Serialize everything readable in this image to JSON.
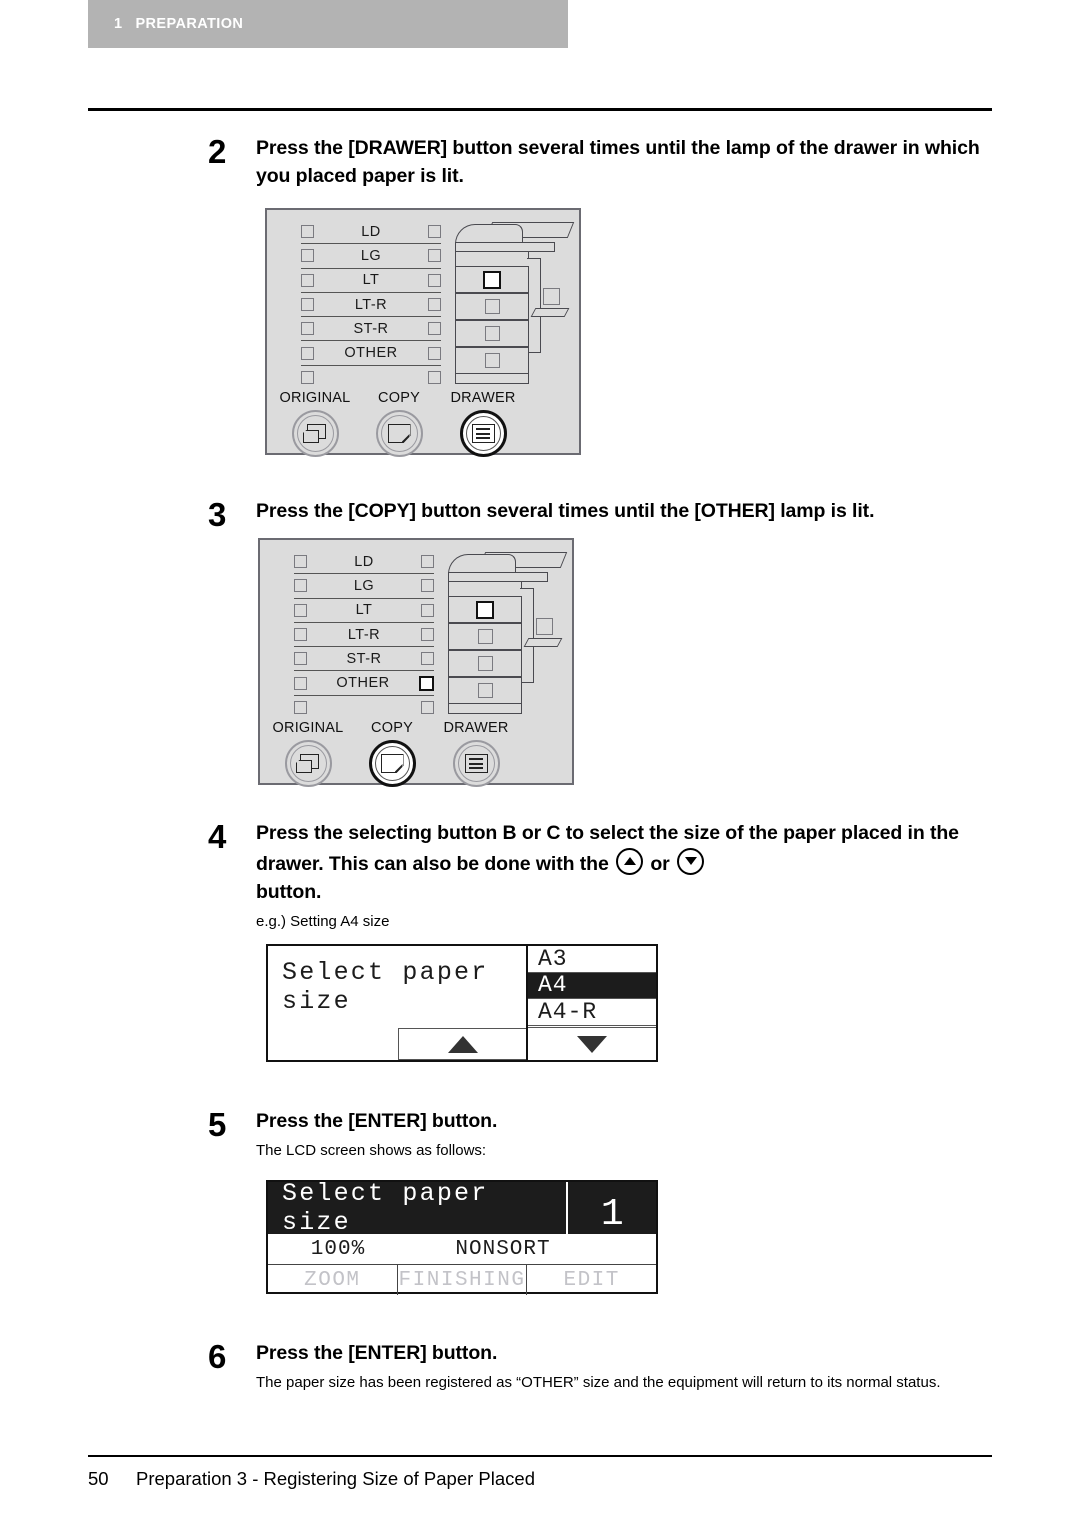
{
  "header": {
    "chapter_number": "1",
    "chapter_title": "PREPARATION"
  },
  "steps": [
    {
      "number": "2",
      "title": "Press the [DRAWER] button several times until the lamp of the drawer in which you placed paper is lit.",
      "sub": ""
    },
    {
      "number": "3",
      "title": "Press the [COPY] button several times until the [OTHER] lamp is lit.",
      "sub": ""
    },
    {
      "number": "4",
      "title_part1": "Press the selecting button B or C to select the size of the paper placed in the drawer. This can also be done with the",
      "title_or": "or",
      "title_part2": "button.",
      "sub": "e.g.) Setting A4 size"
    },
    {
      "number": "5",
      "title": "Press the [ENTER] button.",
      "sub": "The LCD screen shows as follows:"
    },
    {
      "number": "6",
      "title": "Press the [ENTER] button.",
      "sub": "The paper size has been registered as “OTHER” size and the equipment will return to its normal status."
    }
  ],
  "panel_figures": [
    {
      "caption": "drawer-button-step",
      "lamp_rows": [
        {
          "label": "LD",
          "left_lit": false,
          "right_lit": false
        },
        {
          "label": "LG",
          "left_lit": false,
          "right_lit": false
        },
        {
          "label": "LT",
          "left_lit": false,
          "right_lit": false
        },
        {
          "label": "LT-R",
          "left_lit": false,
          "right_lit": false
        },
        {
          "label": "ST-R",
          "left_lit": false,
          "right_lit": false
        },
        {
          "label": "OTHER",
          "left_lit": false,
          "right_lit": false
        },
        {
          "label": "",
          "left_lit": false,
          "right_lit": false
        }
      ],
      "buttons": [
        {
          "label": "ORIGINAL",
          "icon": "original-sheet-icon",
          "active": false
        },
        {
          "label": "COPY",
          "icon": "copy-sheet-icon",
          "active": false
        },
        {
          "label": "DRAWER",
          "icon": "drawer-lines-icon",
          "active": true
        }
      ],
      "machine_drawer_lit_index": 0
    },
    {
      "caption": "copy-button-step",
      "lamp_rows": [
        {
          "label": "LD",
          "left_lit": false,
          "right_lit": false
        },
        {
          "label": "LG",
          "left_lit": false,
          "right_lit": false
        },
        {
          "label": "LT",
          "left_lit": false,
          "right_lit": false
        },
        {
          "label": "LT-R",
          "left_lit": false,
          "right_lit": false
        },
        {
          "label": "ST-R",
          "left_lit": false,
          "right_lit": false
        },
        {
          "label": "OTHER",
          "left_lit": false,
          "right_lit": true
        },
        {
          "label": "",
          "left_lit": false,
          "right_lit": false
        }
      ],
      "buttons": [
        {
          "label": "ORIGINAL",
          "icon": "original-sheet-icon",
          "active": false
        },
        {
          "label": "COPY",
          "icon": "copy-sheet-icon",
          "active": true
        },
        {
          "label": "DRAWER",
          "icon": "drawer-lines-icon",
          "active": false
        }
      ],
      "machine_drawer_lit_index": 0
    }
  ],
  "lcd_select": {
    "title": "Select paper size",
    "options": [
      {
        "label": "A3",
        "selected": false
      },
      {
        "label": "A4",
        "selected": true
      },
      {
        "label": "A4-R",
        "selected": false
      }
    ],
    "up_arrow": "scroll-up-arrow",
    "down_arrow": "scroll-down-arrow"
  },
  "lcd_status": {
    "title": "Select paper size",
    "copy_count": "1",
    "zoom_value": "100%",
    "sort_mode": "NONSORT",
    "soft_keys": [
      "ZOOM",
      "FINISHING",
      "EDIT"
    ]
  },
  "footer": {
    "page_number": "50",
    "section_title": "Preparation 3 - Registering Size of Paper Placed"
  },
  "colors": {
    "header_band": "#b3b3b3",
    "panel_bg": "#dcdcdc",
    "lcd_invert": "#1c1c1c",
    "soft_key_text": "#c3c3c8"
  }
}
